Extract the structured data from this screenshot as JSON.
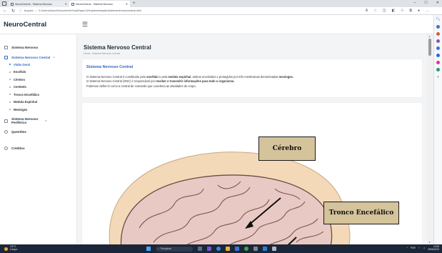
{
  "browser": {
    "tabs": [
      {
        "title": "NeuroCentral - Sistema Nervoso",
        "active": false
      },
      {
        "title": "NeuroCentral - Sistema Nervoso",
        "active": true
      }
    ],
    "new_tab": "+",
    "window_controls": [
      "–",
      "☐",
      "✕"
    ],
    "address": {
      "scheme_label": "Arquivo",
      "url": "C:/Users/Aluno/Documents/YuryEtapa-02/implementação/sistemanervosocentral.html"
    }
  },
  "app": {
    "brand": "NeuroCentral",
    "menu_icon": "☰"
  },
  "sidebar": {
    "items": [
      {
        "label": "Sistema Nervoso",
        "icon": "book-icon"
      },
      {
        "label": "Sistema Nervoso Central",
        "icon": "brain-icon",
        "chevron": "^"
      }
    ],
    "subitems": [
      {
        "label": "Visão Geral"
      },
      {
        "label": "Encéfalo"
      },
      {
        "label": "Cérebro"
      },
      {
        "label": "Cerebelo"
      },
      {
        "label": "Tronco Encefálico"
      },
      {
        "label": "Medula Espinhal"
      },
      {
        "label": "Meninges"
      }
    ],
    "peripheral": {
      "line1": "Sistema Nervoso",
      "line2": "Periférico",
      "chevron": "v"
    },
    "questions": "Questões",
    "credits": "Créditos"
  },
  "main": {
    "title": "Sistema Nervoso Central",
    "breadcrumb": "Home / Sistema Nervoso Central",
    "card": {
      "title": "Sistema Nervoso Central",
      "line1_a": "O Sistema Nervoso Central é constituído pelo ",
      "line1_b": "encéfalo",
      "line1_c": " e pela ",
      "line1_d": "medula espinhal",
      "line1_e": ", ambos envolvidos e protegidos por três membranas denominadas ",
      "line1_f": "meninges.",
      "line2_a": "O Sistema Nervoso Central (SNC) é responsável por ",
      "line2_b": "receber e transmitir informações para todo o organismo.",
      "line3": "Podemos defini-lo como a central de comando que coordena as atividades do corpo."
    },
    "figure": {
      "label_cerebro": "Cérebro",
      "label_tronco": "Tronco Encefálico"
    }
  },
  "taskbar": {
    "weather_temp": "13°C",
    "weather_desc": "Limpo",
    "search_placeholder": "Pesquisar",
    "tray_lang": "POR",
    "time": "13:55",
    "date": "26/06/2023"
  }
}
